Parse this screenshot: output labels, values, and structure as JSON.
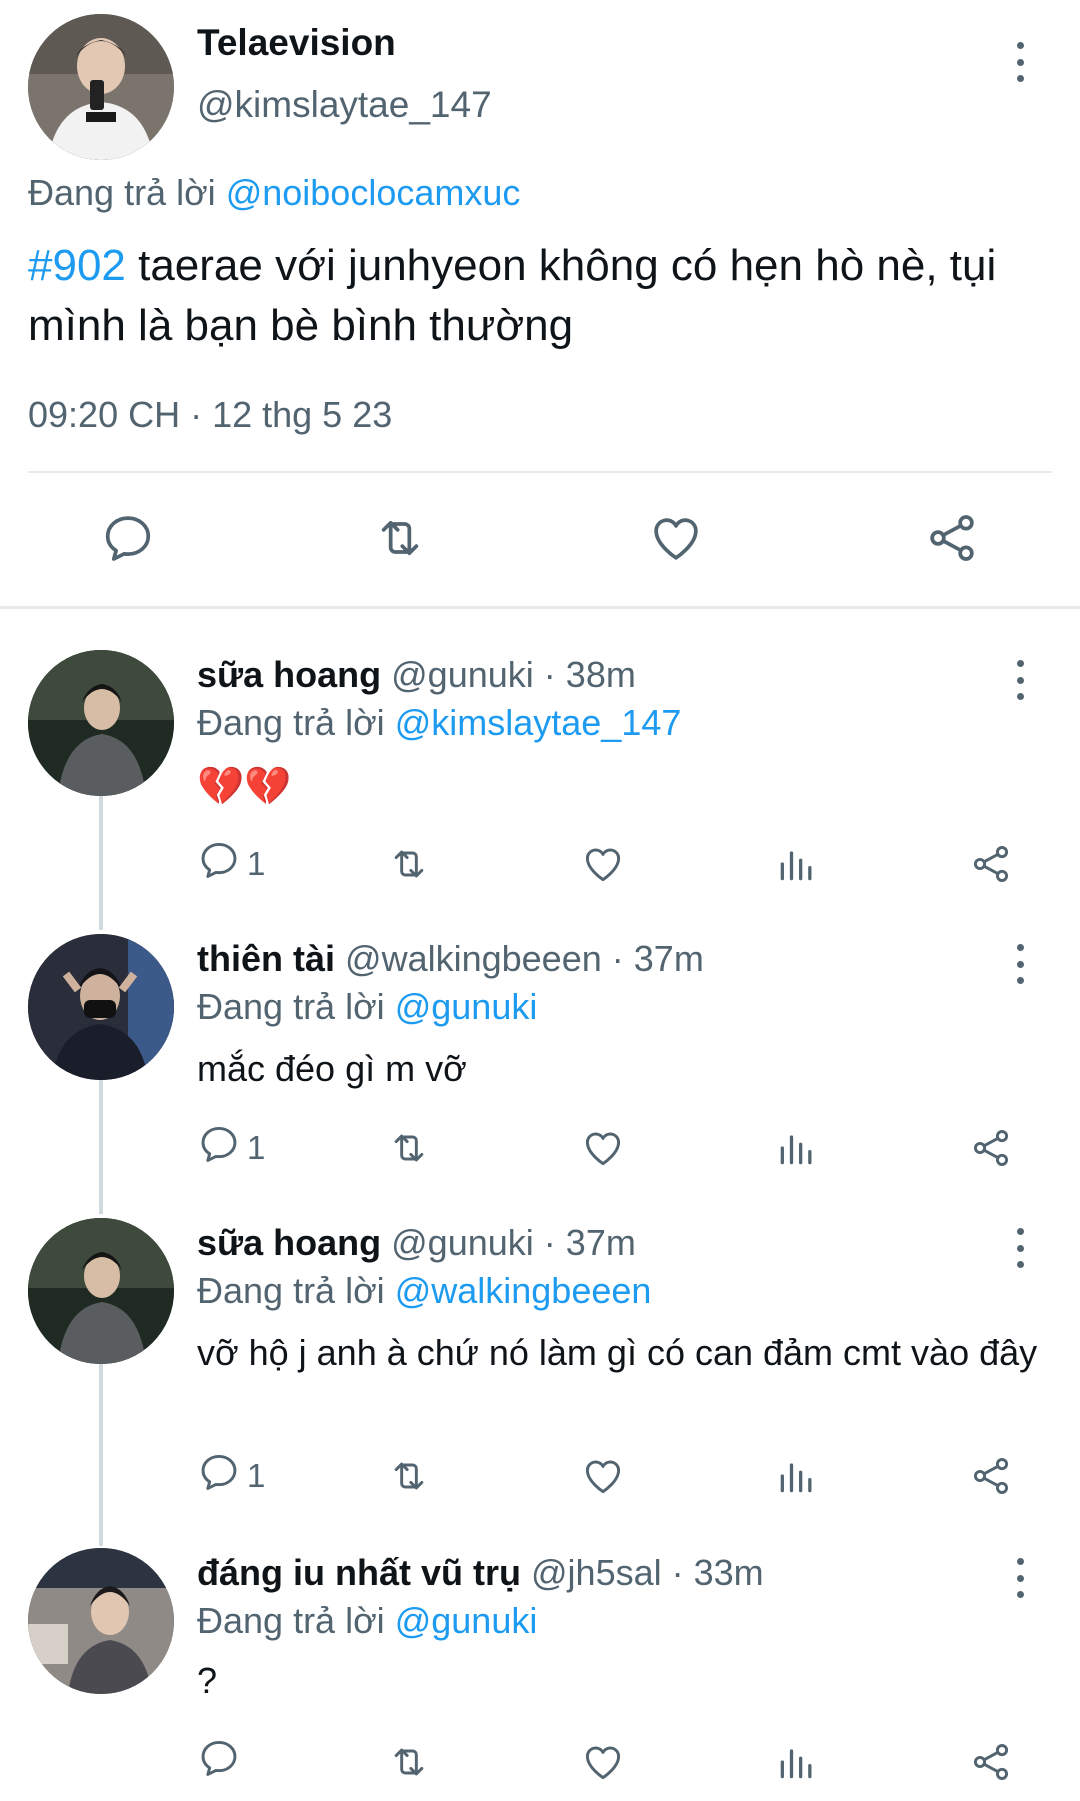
{
  "main_tweet": {
    "display_name": "Telaevision",
    "handle": "@kimslaytae_147",
    "replying_prefix": "Đang trả lời",
    "replying_to": "@noiboclocamxuc",
    "hashtag": "#902",
    "text": " taerae với junhyeon không có hẹn hò nè, tụi mình là bạn bè bình thường",
    "timestamp": "09:20 CH · 12 thg 5 23",
    "actions": [
      "reply-icon",
      "retweet-icon",
      "like-icon",
      "share-icon"
    ]
  },
  "replies": [
    {
      "display_name": "sữa hoang",
      "handle": "@gunuki",
      "age": "38m",
      "replying_prefix": "Đang trả lời",
      "replying_to": "@kimslaytae_147",
      "text": "💔💔",
      "reply_count": "1"
    },
    {
      "display_name": "thiên tài",
      "handle": "@walkingbeeen",
      "age": "37m",
      "replying_prefix": "Đang trả lời",
      "replying_to": "@gunuki",
      "text": "mắc đéo gì m vỡ",
      "reply_count": "1"
    },
    {
      "display_name": "sữa hoang",
      "handle": "@gunuki",
      "age": "37m",
      "replying_prefix": "Đang trả lời",
      "replying_to": "@walkingbeeen",
      "text": "vỡ hộ j anh à chứ nó làm gì có can đảm cmt vào đây",
      "reply_count": "1"
    },
    {
      "display_name": "đáng iu nhất vũ trụ",
      "handle": "@jh5sal",
      "age": "33m",
      "replying_prefix": "Đang trả lời",
      "replying_to": "@gunuki",
      "text": "?",
      "reply_count": ""
    }
  ],
  "colors": {
    "link": "#1d9bf0",
    "muted": "#536471",
    "text": "#0f1419",
    "divider": "#e7ebee",
    "thread_line": "#cfd9de"
  }
}
